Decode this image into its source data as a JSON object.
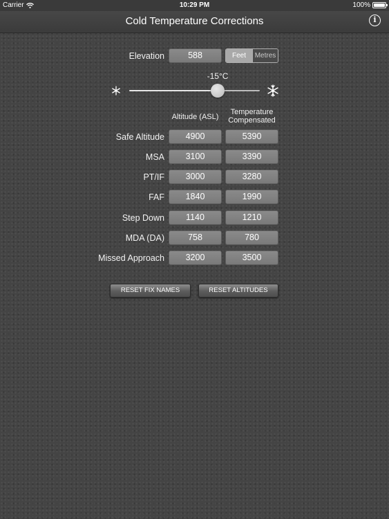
{
  "status_bar": {
    "carrier": "Carrier",
    "time": "10:29 PM",
    "battery": "100%"
  },
  "nav": {
    "title": "Cold Temperature Corrections",
    "info_glyph": "i"
  },
  "elevation": {
    "label": "Elevation",
    "value": "588",
    "units": {
      "feet": "Feet",
      "metres": "Metres",
      "selected": "Feet"
    }
  },
  "temperature": {
    "label": "-15°C",
    "value_c": -15,
    "slider_fraction": 0.68
  },
  "icons": {
    "cold": "snowflake-small-icon",
    "colder": "snowflake-large-icon"
  },
  "columns": {
    "altitude": "Altitude (ASL)",
    "compensated_line1": "Temperature",
    "compensated_line2": "Compensated"
  },
  "rows": [
    {
      "label": "Safe Altitude",
      "altitude": "4900",
      "compensated": "5390"
    },
    {
      "label": "MSA",
      "altitude": "3100",
      "compensated": "3390"
    },
    {
      "label": "PT/IF",
      "altitude": "3000",
      "compensated": "3280"
    },
    {
      "label": "FAF",
      "altitude": "1840",
      "compensated": "1990"
    },
    {
      "label": "Step Down",
      "altitude": "1140",
      "compensated": "1210"
    },
    {
      "label": "MDA (DA)",
      "altitude": "758",
      "compensated": "780"
    },
    {
      "label": "Missed Approach",
      "altitude": "3200",
      "compensated": "3500"
    }
  ],
  "buttons": {
    "reset_fix_names": "RESET FIX NAMES",
    "reset_altitudes": "RESET ALTITUDES"
  },
  "colors": {
    "background": "#444444",
    "field": "#808080",
    "text": "#ffffff"
  }
}
